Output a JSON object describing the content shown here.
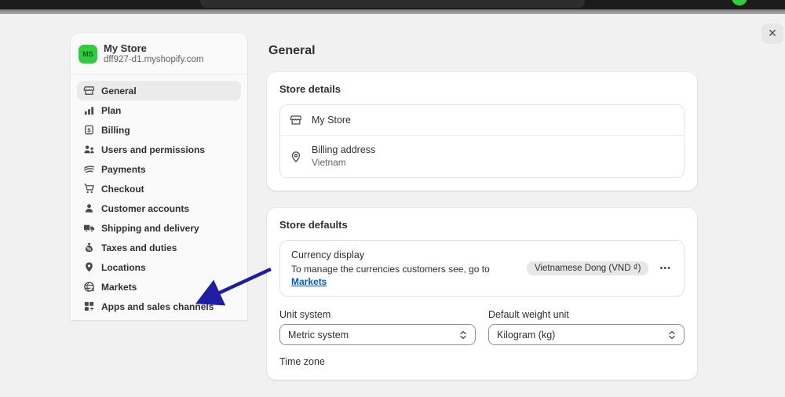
{
  "icons": {
    "close": "✕",
    "overflow_menu": "•••"
  },
  "sidebar": {
    "store_name": "My Store",
    "store_domain": "dff927-d1.myshopify.com",
    "avatar_initials": "MS",
    "items": [
      {
        "label": "General",
        "icon": "storefront-icon",
        "selected": true
      },
      {
        "label": "Plan",
        "icon": "plan-icon",
        "selected": false
      },
      {
        "label": "Billing",
        "icon": "billing-icon",
        "selected": false
      },
      {
        "label": "Users and permissions",
        "icon": "users-icon",
        "selected": false
      },
      {
        "label": "Payments",
        "icon": "payments-icon",
        "selected": false
      },
      {
        "label": "Checkout",
        "icon": "checkout-icon",
        "selected": false
      },
      {
        "label": "Customer accounts",
        "icon": "customer-accounts-icon",
        "selected": false
      },
      {
        "label": "Shipping and delivery",
        "icon": "shipping-icon",
        "selected": false
      },
      {
        "label": "Taxes and duties",
        "icon": "taxes-icon",
        "selected": false
      },
      {
        "label": "Locations",
        "icon": "locations-icon",
        "selected": false
      },
      {
        "label": "Markets",
        "icon": "markets-icon",
        "selected": false
      },
      {
        "label": "Apps and sales channels",
        "icon": "apps-icon",
        "selected": false
      }
    ]
  },
  "main": {
    "title": "General",
    "store_details": {
      "title": "Store details",
      "store_row_label": "My Store",
      "billing_row_label": "Billing address",
      "billing_row_value": "Vietnam"
    },
    "store_defaults": {
      "title": "Store defaults",
      "currency_label": "Currency display",
      "currency_desc_prefix": "To manage the currencies customers see, go to ",
      "currency_link": "Markets",
      "currency_badge": "Vietnamese Dong (VND ₫)",
      "unit_system_label": "Unit system",
      "unit_system_value": "Metric system",
      "weight_unit_label": "Default weight unit",
      "weight_unit_value": "Kilogram (kg)",
      "next_section_label": "Time zone"
    }
  },
  "annotation": {
    "arrow_color": "#1e1ea4"
  }
}
